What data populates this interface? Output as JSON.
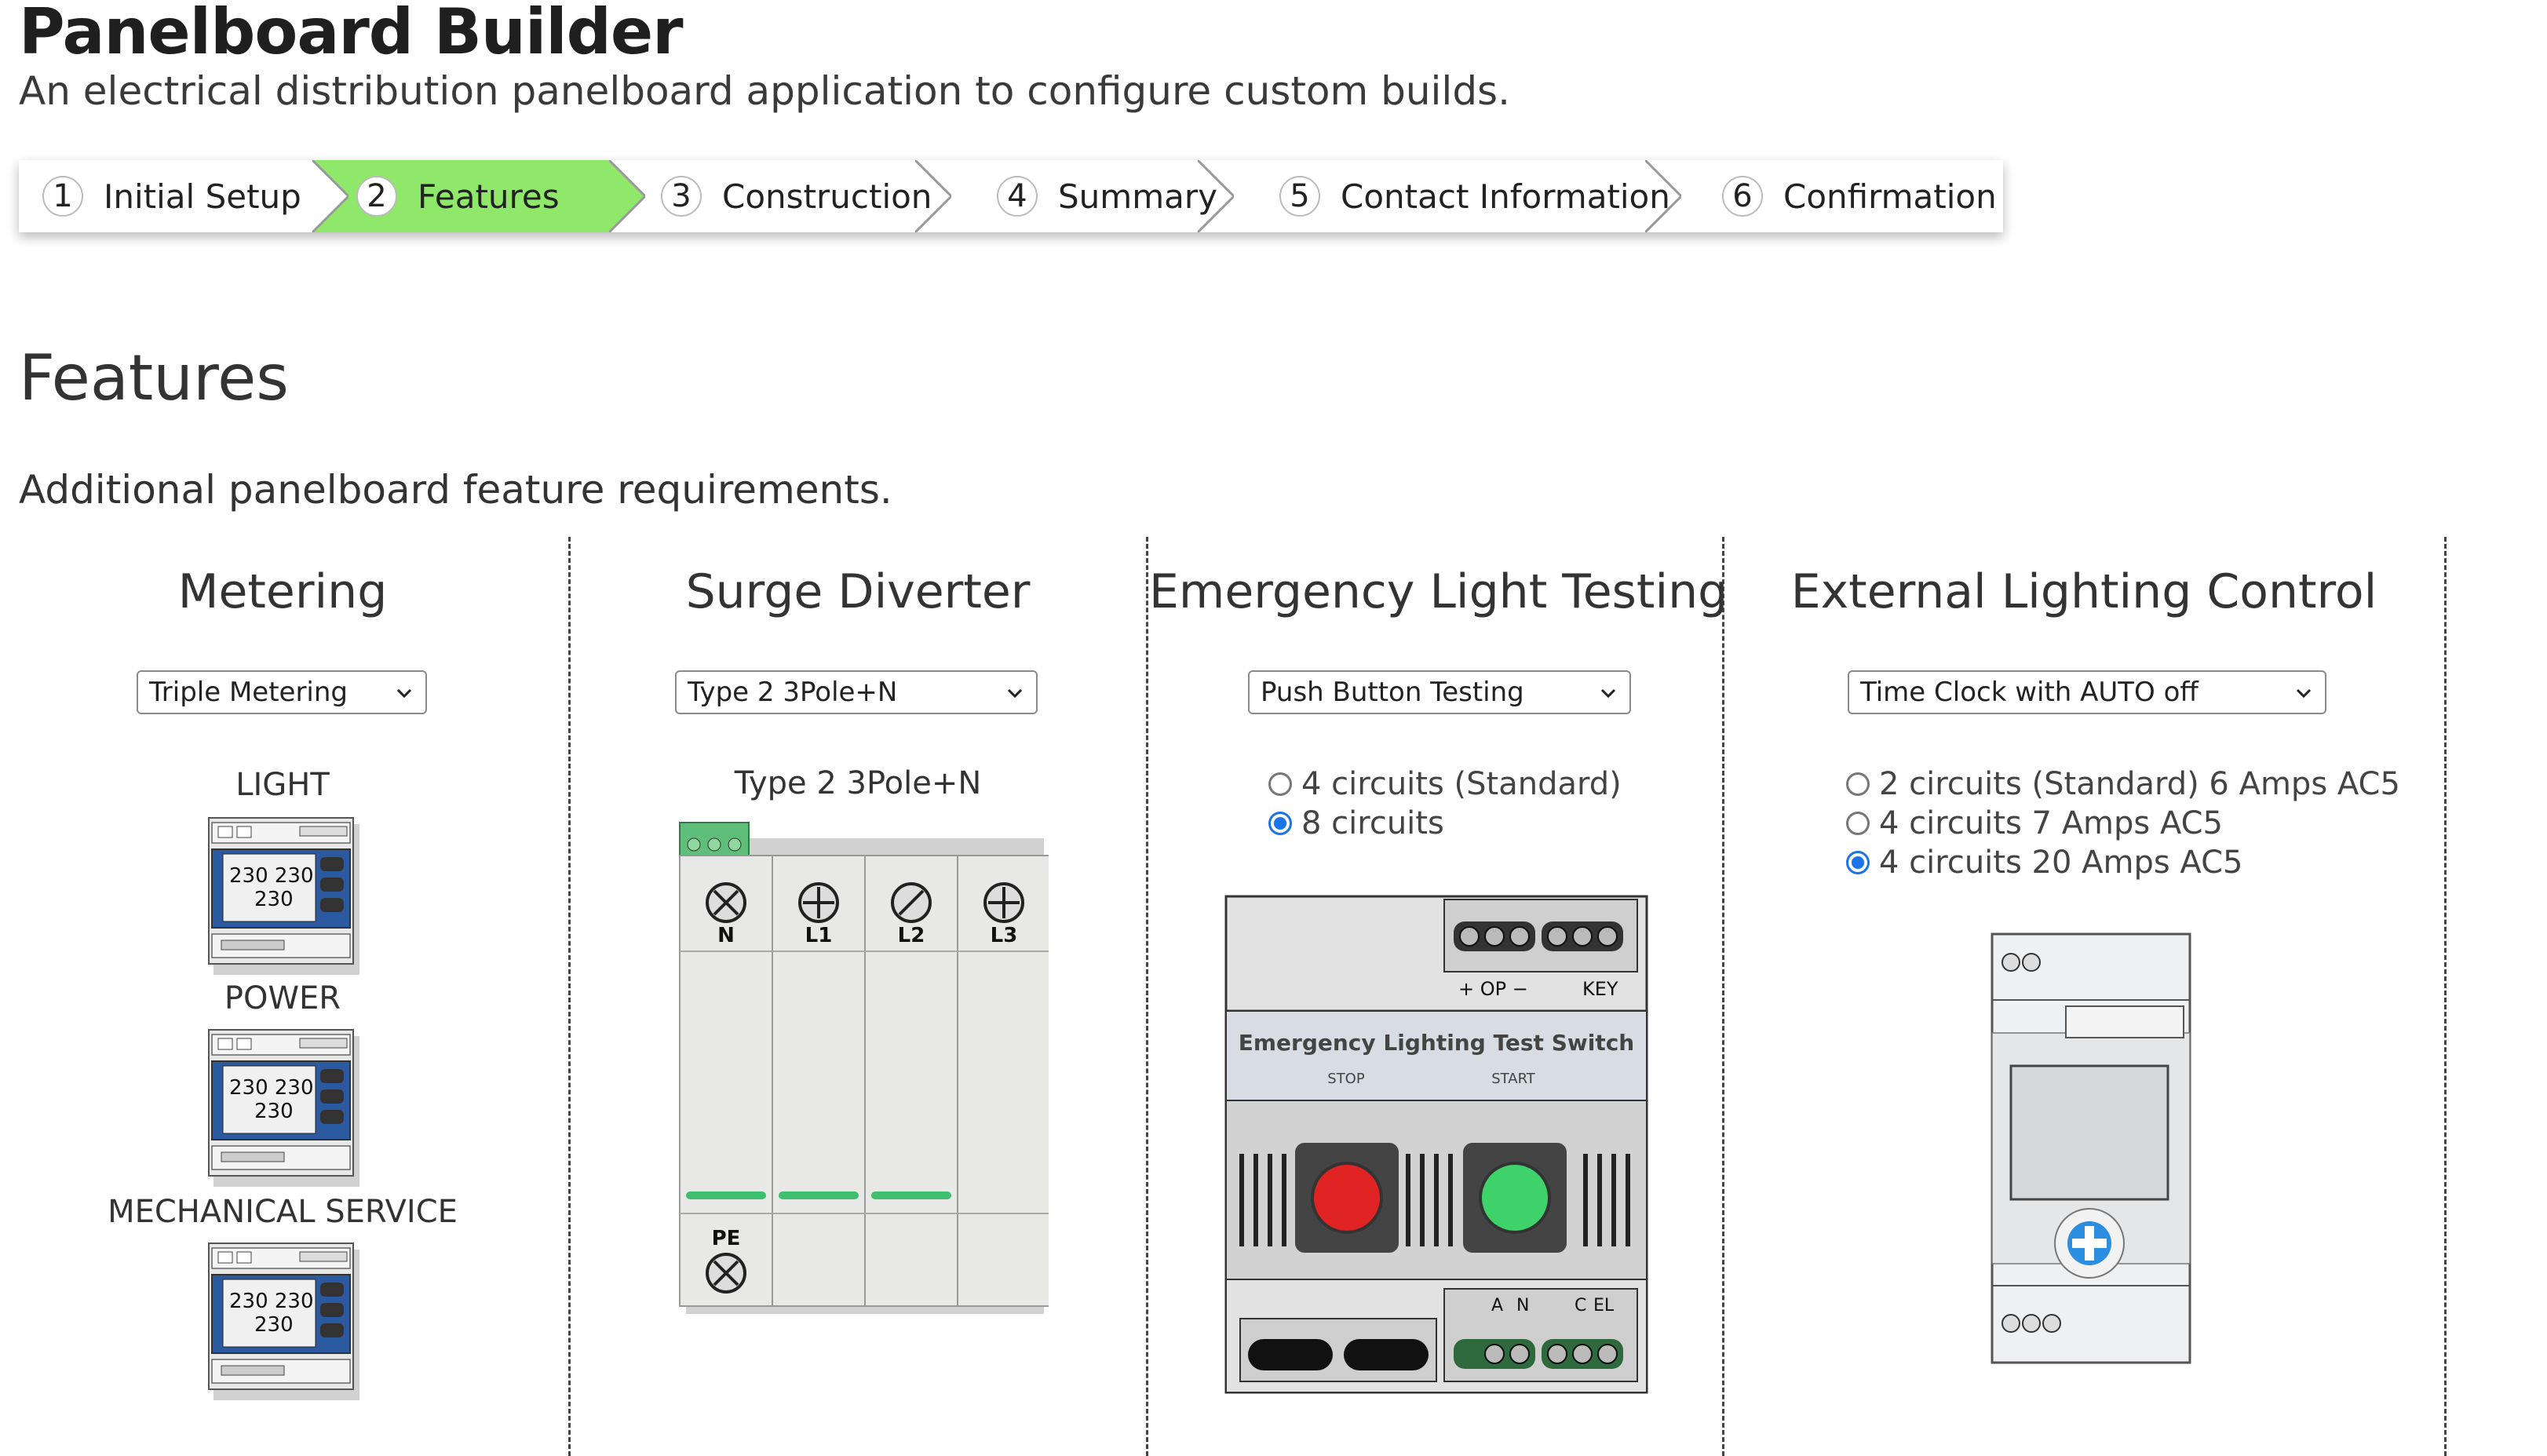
{
  "app": {
    "title": "Panelboard Builder",
    "subtitle": "An electrical distribution panelboard application to configure custom builds."
  },
  "wizard": {
    "active_color": "#8fe86a",
    "steps": [
      {
        "num": "1",
        "label": "Initial Setup",
        "active": false
      },
      {
        "num": "2",
        "label": "Features",
        "active": true
      },
      {
        "num": "3",
        "label": "Construction",
        "active": false
      },
      {
        "num": "4",
        "label": "Summary",
        "active": false
      },
      {
        "num": "5",
        "label": "Contact Information",
        "active": false
      },
      {
        "num": "6",
        "label": "Confirmation",
        "active": false
      }
    ]
  },
  "section": {
    "title": "Features",
    "description": "Additional panelboard feature requirements."
  },
  "metering": {
    "title": "Metering",
    "select_value": "Triple Metering",
    "meters": [
      {
        "label": "LIGHT"
      },
      {
        "label": "POWER"
      },
      {
        "label": "MECHANICAL SERVICE"
      }
    ],
    "meter_display": {
      "line1": "230 230",
      "line2": "230"
    }
  },
  "surge": {
    "title": "Surge Diverter",
    "select_value": "Type 2 3Pole+N",
    "image_label": "Type 2 3Pole+N",
    "terminals": [
      "N",
      "L1",
      "L2",
      "L3"
    ],
    "pe_label": "PE"
  },
  "emergency": {
    "title": "Emergency Light Testing",
    "select_value": "Push Button Testing",
    "options": [
      {
        "label": "4 circuits (Standard)",
        "checked": false
      },
      {
        "label": "8 circuits",
        "checked": true
      }
    ],
    "device": {
      "plate_title": "Emergency Lighting Test Switch",
      "stop": "STOP",
      "start": "START",
      "top_terminals": "+ OP −",
      "key": "KEY",
      "bottom_a": "A",
      "bottom_n": "N",
      "bottom_c": "C",
      "bottom_el": "EL",
      "stop_color": "#e02424",
      "start_color": "#3fd16a"
    }
  },
  "external": {
    "title": "External Lighting Control",
    "select_value": "Time Clock with AUTO off",
    "options": [
      {
        "label": "2 circuits (Standard) 6 Amps AC5",
        "checked": false
      },
      {
        "label": "4 circuits 7 Amps AC5",
        "checked": false
      },
      {
        "label": "4 circuits 20 Amps AC5",
        "checked": true
      }
    ],
    "button_color": "#2b8ee0"
  }
}
